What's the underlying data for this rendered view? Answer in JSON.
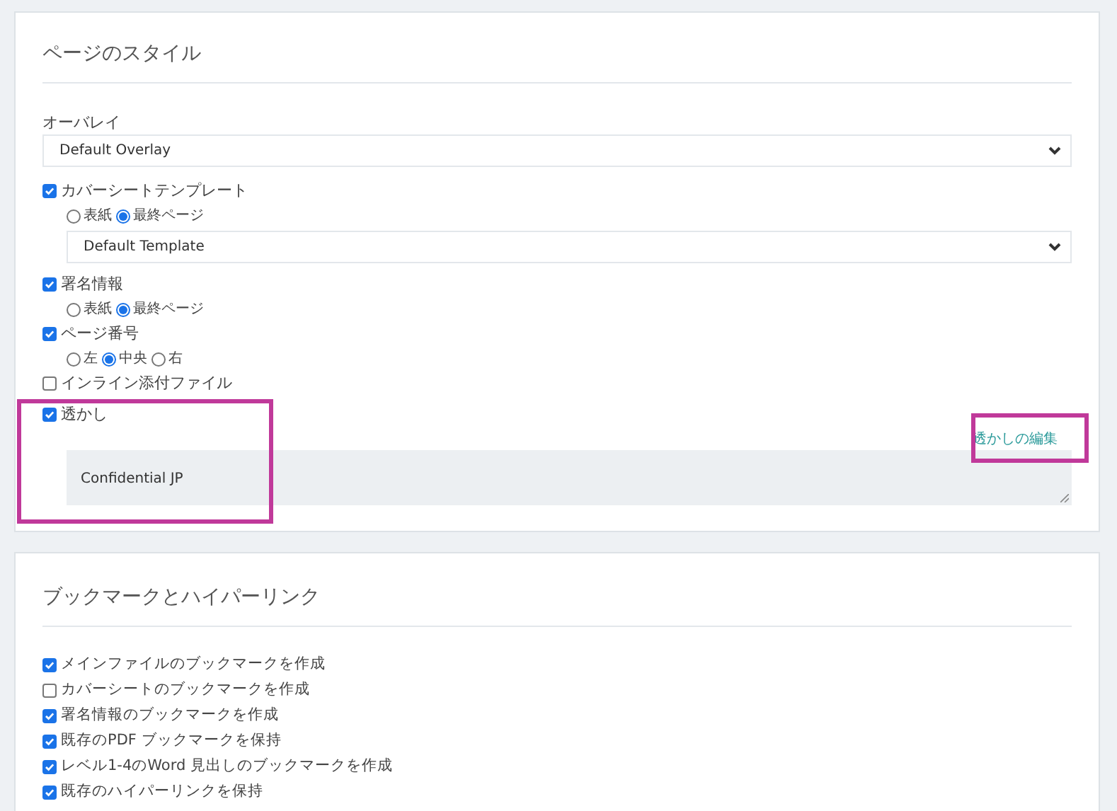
{
  "page_style": {
    "title": "ページのスタイル",
    "overlay": {
      "label": "オーバレイ",
      "value": "Default Overlay"
    },
    "options": [
      {
        "label": "カバーシートテンプレート",
        "checked": true,
        "radios": [
          {
            "label": "表紙",
            "selected": false
          },
          {
            "label": "最終ページ",
            "selected": true
          }
        ],
        "select": "Default Template"
      },
      {
        "label": "署名情報",
        "checked": true,
        "radios": [
          {
            "label": "表紙",
            "selected": false
          },
          {
            "label": "最終ページ",
            "selected": true
          }
        ]
      },
      {
        "label": "ページ番号",
        "checked": true,
        "radios": [
          {
            "label": "左",
            "selected": false
          },
          {
            "label": "中央",
            "selected": true
          },
          {
            "label": "右",
            "selected": false
          }
        ]
      },
      {
        "label": "インライン添付ファイル",
        "checked": false
      }
    ],
    "watermark": {
      "label": "透かし",
      "checked": true,
      "edit_link": "透かしの編集",
      "text": "Confidential JP"
    }
  },
  "bookmarks": {
    "title": "ブックマークとハイパーリンク",
    "items": [
      {
        "label": "メインファイルのブックマークを作成",
        "checked": true
      },
      {
        "label": "カバーシートのブックマークを作成",
        "checked": false
      },
      {
        "label": "署名情報のブックマークを作成",
        "checked": true
      },
      {
        "label": "既存のPDF ブックマークを保持",
        "checked": true
      },
      {
        "label": "レベル1-4のWord 見出しのブックマークを作成",
        "checked": true
      },
      {
        "label": "既存のハイパーリンクを保持",
        "checked": true
      }
    ]
  }
}
